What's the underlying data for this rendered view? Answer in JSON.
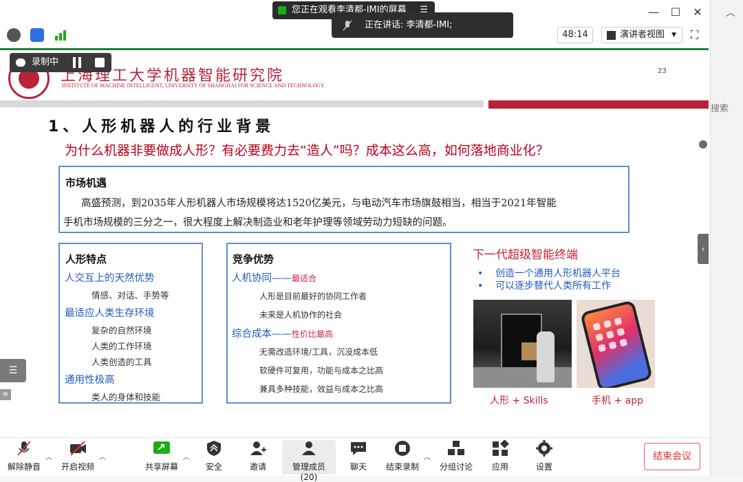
{
  "window": {
    "share_banner": "您正在观看李清都-IMI的屏幕",
    "speaking": "正在讲话: 李清都-IMI;",
    "timer": "48:14",
    "view_mode": "演讲者视图",
    "minimize": "—",
    "maximize": "☐",
    "close": "✕",
    "menu": "☰"
  },
  "right_pane": {
    "collapse": "︿",
    "search": "搜索"
  },
  "recording": {
    "label": "录制中"
  },
  "slide": {
    "uni_name": "上海理工大学机器智能研究院",
    "uni_en": "INSTITUTE OF MACHINE INTELLIGENT, UNIVERSITY OF SHANGHAI FOR SCIENCE AND TECHNOLOGY",
    "page_no": "23",
    "heading": "1、人形机器人的行业背景",
    "question": "为什么机器非要做成人形？有必要费力去“造人”吗？成本这么高，如何落地商业化？",
    "market": {
      "title": "市场机遇",
      "line1": "高盛预测，到2035年人形机器人市场规模将达1520亿美元，与电动汽车市场旗鼓相当，相当于2021年智能",
      "line2": "手机市场规模的三分之一，很大程度上解决制造业和老年护理等领域劳动力短缺的问题。"
    },
    "features": {
      "title": "人形特点",
      "item1": "人交互上的天然优势",
      "item1_sub": "情感、对话、手势等",
      "item2": "最适应人类生存环境",
      "item2_sub1": "复杂的自然环境",
      "item2_sub2": "人类的工作环境",
      "item2_sub3": "人类创造的工具",
      "item3": "通用性极高",
      "item3_sub": "类人的身体和技能"
    },
    "advantage": {
      "title": "竞争优势",
      "item1": "人机协同——",
      "item1_tag": "最适合",
      "item1_sub1": "人形是目前最好的协同工作者",
      "item1_sub2": "未来是人机协作的社会",
      "item2": "综合成本——",
      "item2_tag": "性价比最高",
      "item2_sub1": "无需改造环境/工具，沉没成本低",
      "item2_sub2": "软硬件可复用，功能与成本之比高",
      "item2_sub3": "兼具多种技能，效益与成本之比高"
    },
    "next_gen": {
      "title": "下一代超级智能终端",
      "bullet1": "创造一个通用人形机器人平台",
      "bullet2": "可以逐步替代人类所有工作",
      "caption1": "人形 + Skills",
      "caption2": "手机 + app"
    }
  },
  "bottom_bar": {
    "mute": "解除静音",
    "video": "开启视频",
    "share": "共享屏幕",
    "security": "安全",
    "invite": "邀请",
    "members": "管理成员(20)",
    "chat": "聊天",
    "end_record": "结束录制",
    "breakout": "分组讨论",
    "apps": "应用",
    "settings": "设置",
    "end_meeting": "结束会议"
  },
  "colors": {
    "brand_red": "#b8233a",
    "link_blue": "#1f5bbf",
    "box_border": "#5b8fd1",
    "end_red": "#e03030"
  }
}
